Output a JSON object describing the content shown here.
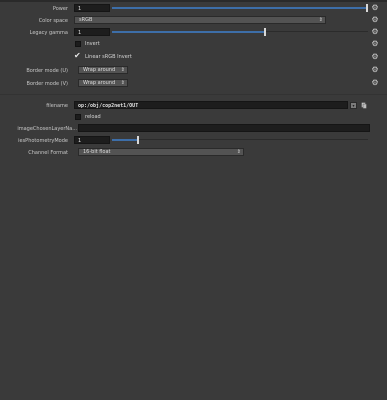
{
  "params": {
    "power": {
      "label": "Power",
      "value": "1",
      "slider_fraction": 1.0
    },
    "color_space": {
      "label": "Color space",
      "value": "sRGB"
    },
    "legacy_gamma": {
      "label": "Legacy gamma",
      "value": "1",
      "slider_fraction": 0.6
    },
    "invert": {
      "label": "Invert",
      "checked": false
    },
    "linear_srgb_invert": {
      "label": "Linear sRGB Invert",
      "checked": true
    },
    "border_mode_u": {
      "label": "Border mode (U)",
      "value": "Wrap around"
    },
    "border_mode_v": {
      "label": "Border mode (V)",
      "value": "Wrap around"
    },
    "filename": {
      "label": "filename",
      "value": "op:/obj/cop2net1/OUT"
    },
    "reload": {
      "label": "reload",
      "checked": false
    },
    "image_layer": {
      "label": "imageChosenLayerNa...",
      "value": ""
    },
    "ies_mode": {
      "label": "iesPhotometryMode",
      "value": "1",
      "slider_fraction": 0.1
    },
    "channel_format": {
      "label": "Channel Format",
      "value": "16-bit float"
    }
  },
  "icons": {
    "gear": "gear-icon",
    "arrows": "updown-arrows-icon"
  },
  "colors": {
    "accent": "#3d6ea8",
    "panel": "#3a3a3a",
    "field": "#1d1d1d"
  }
}
